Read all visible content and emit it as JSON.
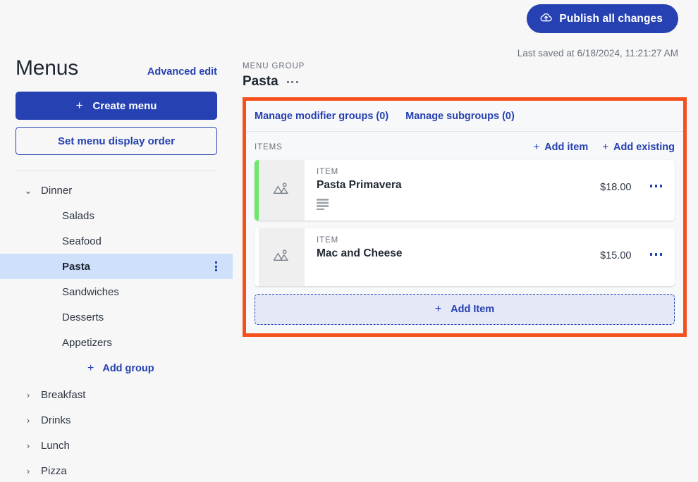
{
  "topbar": {
    "publish_label": "Publish all changes",
    "publish_icon": "cloud-upload-icon",
    "last_saved": "Last saved at 6/18/2024, 11:21:27 AM",
    "accent_color": "#2541b2"
  },
  "sidebar": {
    "title": "Menus",
    "advanced_edit_label": "Advanced edit",
    "create_menu_label": "Create menu",
    "create_menu_plus": "+",
    "set_order_label": "Set menu display order",
    "add_group_label": "Add group",
    "add_group_plus": "+",
    "selected_highlight_color": "#cfe0fb",
    "tree": [
      {
        "label": "Dinner",
        "expanded": true,
        "caret": "⌄",
        "children": [
          {
            "label": "Salads",
            "selected": false
          },
          {
            "label": "Seafood",
            "selected": false
          },
          {
            "label": "Pasta",
            "selected": true
          },
          {
            "label": "Sandwiches",
            "selected": false
          },
          {
            "label": "Desserts",
            "selected": false
          },
          {
            "label": "Appetizers",
            "selected": false
          }
        ]
      },
      {
        "label": "Breakfast",
        "expanded": false,
        "caret": "›",
        "children": []
      },
      {
        "label": "Drinks",
        "expanded": false,
        "caret": "›",
        "children": []
      },
      {
        "label": "Lunch",
        "expanded": false,
        "caret": "›",
        "children": []
      },
      {
        "label": "Pizza",
        "expanded": false,
        "caret": "›",
        "children": []
      }
    ]
  },
  "main": {
    "group_eyebrow": "MENU GROUP",
    "group_title": "Pasta",
    "highlight_border_color": "#f4511e",
    "tabs": [
      {
        "label": "Manage modifier groups (0)"
      },
      {
        "label": "Manage subgroups (0)"
      }
    ],
    "items_label": "ITEMS",
    "add_item_link": "Add item",
    "add_existing_link": "Add existing",
    "add_item_plus": "+",
    "add_existing_plus": "+",
    "items": [
      {
        "eyebrow": "ITEM",
        "name": "Pasta Primavera",
        "price": "$18.00",
        "accent": "green",
        "accent_color": "#6de86d",
        "has_description": true,
        "thumb_icon": "image-placeholder-icon"
      },
      {
        "eyebrow": "ITEM",
        "name": "Mac and Cheese",
        "price": "$15.00",
        "accent": "none",
        "accent_color": "",
        "has_description": false,
        "thumb_icon": "image-placeholder-icon"
      }
    ],
    "add_item_button_label": "Add Item",
    "add_item_button_plus": "+"
  }
}
